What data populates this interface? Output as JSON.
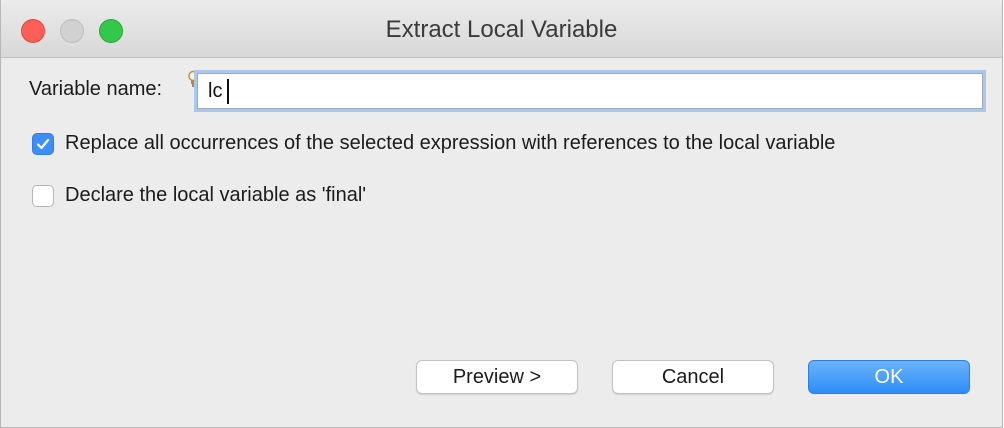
{
  "window": {
    "title": "Extract Local Variable"
  },
  "form": {
    "variable_name_label": "Variable name:",
    "variable_name_value": "lc"
  },
  "options": {
    "replace_all": {
      "label": "Replace all occurrences of the selected expression with references to the local variable",
      "checked": true
    },
    "declare_final": {
      "label": "Declare the local variable as 'final'",
      "checked": false
    }
  },
  "buttons": {
    "preview_label": "Preview >",
    "cancel_label": "Cancel",
    "ok_label": "OK"
  },
  "colors": {
    "accent": "#3d8ef7",
    "close": "#fc5f57",
    "zoom": "#34c84a",
    "focus_ring": "#a9c8f0"
  },
  "icons": [
    "close-icon",
    "minimize-icon",
    "zoom-icon",
    "lightbulb-icon",
    "checkmark-icon"
  ]
}
